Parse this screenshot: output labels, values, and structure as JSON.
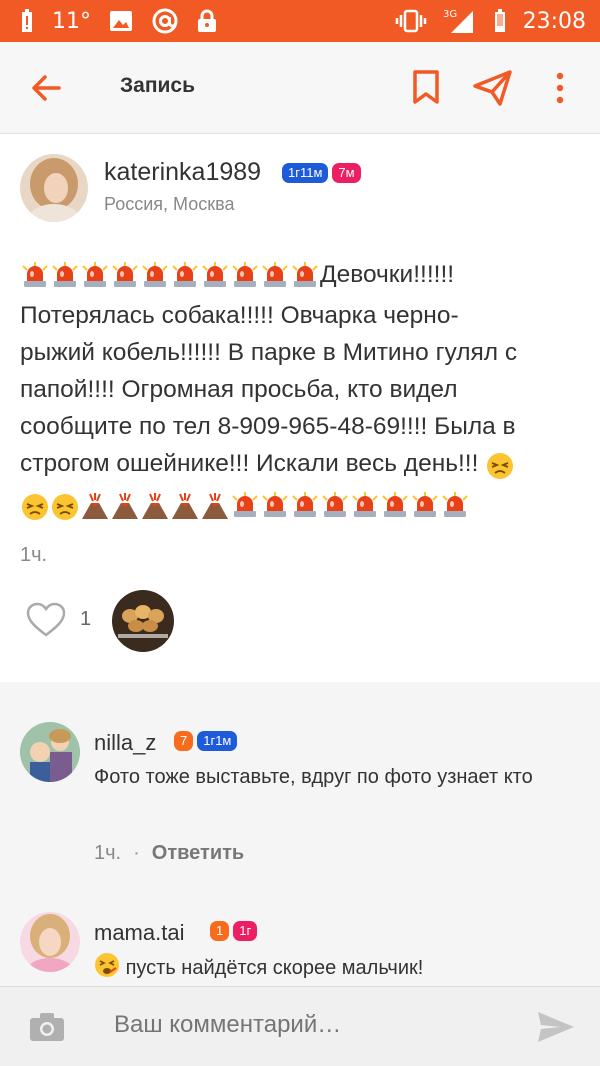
{
  "status_bar": {
    "temperature": "11°",
    "time": "23:08",
    "network": "3G",
    "background_color": "#f15a24"
  },
  "app_bar": {
    "title": "Запись",
    "accent_color": "#f15a24",
    "icons": [
      "back-arrow-icon",
      "bookmark-icon",
      "share-send-icon",
      "more-vert-icon"
    ]
  },
  "post": {
    "author": "katerinka1989",
    "badges": [
      {
        "label": "1г11м",
        "color": "#1e5bd8"
      },
      {
        "label": "7м",
        "color": "#ec1f62"
      }
    ],
    "location": "Россия, Москва",
    "text": "Девочки!!!!!! Потерялась собака!!!!! Овчарка черно-рыжий кобель!!!!!! В парке в Митино гулял с папой!!!! Огромная просьба, кто видел сообщите по тел 8-909-965-48-69!!!! Была в строгом ошейнике!!! Искали весь день!!!",
    "text_line1": "Девочки!!!!!!",
    "text_line2": "Потерялась собака!!!!! Овчарка черно-",
    "text_line3": "рыжий кобель!!!!!! В парке в Митино гулял с",
    "text_line4": "папой!!!! Огромная просьба, кто видел",
    "text_line5": "сообщите по тел 8-909-965-48-69!!!! Была в",
    "text_line6": "строгом ошейнике!!! Искали весь день!!!",
    "leading_emoji": "siren-emoji x10",
    "trailing_emoji": [
      "persevering-face-emoji x3",
      "volcano-emoji x5",
      "siren-emoji x8"
    ],
    "time": "1ч.",
    "like_count": "1"
  },
  "comments": [
    {
      "author": "nilla_z",
      "badges": [
        {
          "label": "7",
          "color": "#f76b1c"
        },
        {
          "label": "1г1м",
          "color": "#1e5bd8"
        }
      ],
      "text": "Фото тоже выставьте, вдруг по фото узнает кто",
      "time": "1ч.",
      "reply_label": "Ответить"
    },
    {
      "author": "mama.tai",
      "badges": [
        {
          "label": "1",
          "color": "#f76b1c"
        },
        {
          "label": "1г",
          "color": "#ec1f62"
        }
      ],
      "text": "пусть найдётся скорее мальчик!"
    }
  ],
  "comment_input": {
    "placeholder": "Ваш комментарий…"
  }
}
